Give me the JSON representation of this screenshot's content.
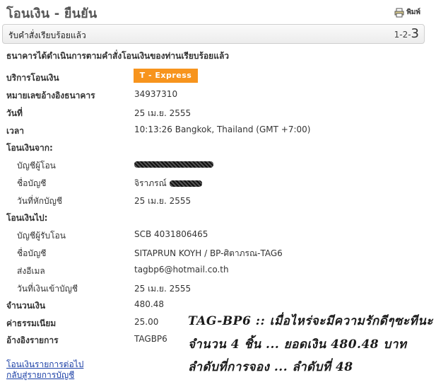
{
  "header": {
    "title": "โอนเงิน - ยืนยัน",
    "print_label": "พิมพ์"
  },
  "status": {
    "message": "รับคำสั่งเรียบร้อยแล้ว",
    "steps_prefix": "1-2-",
    "steps_current": "3"
  },
  "notice": "ธนาคารได้ดำเนินการตามคำสั่งโอนเงินของท่านเรียบร้อยแล้ว",
  "details": {
    "service_label": "บริการโอนเงิน",
    "service_value": "T - Express",
    "reference_label": "หมายเลขอ้างอิงธนาคาร",
    "reference_value": "34937310",
    "date_label": "วันที่",
    "date_value": "25 เม.ย. 2555",
    "time_label": "เวลา",
    "time_value": "10:13:26 Bangkok, Thailand (GMT +7:00)"
  },
  "from": {
    "heading": "โอนเงินจาก:",
    "account_label": "บัญชีผู้โอน",
    "name_label": "ชื่อบัญชี",
    "name_value_visible": "จิราภรณ์",
    "debit_date_label": "วันที่หักบัญชี",
    "debit_date_value": "25 เม.ย. 2555"
  },
  "to": {
    "heading": "โอนเงินไป:",
    "account_label": "บัญชีผู้รับโอน",
    "account_value": "SCB 4031806465",
    "name_label": "ชื่อบัญชี",
    "name_value": "SITAPRUN KOYH / BP-ศิตาภรณ-TAG6",
    "email_label": "ส่งอีเมล",
    "email_value": "tagbp6@hotmail.co.th",
    "credit_date_label": "วันที่เงินเข้าบัญชี",
    "credit_date_value": "25 เม.ย. 2555"
  },
  "amount": {
    "label": "จำนวนเงิน",
    "value": "480.48"
  },
  "fee": {
    "label": "ค่าธรรมเนียม",
    "value": "25.00"
  },
  "note_ref": {
    "label": "อ้างอิงรายการ",
    "value": "TAGBP6"
  },
  "links": {
    "next_transfer": "โอนเงินรายการต่อไป",
    "back_to_accounts": "กลับสู่รายการบัญชี"
  },
  "handwriting": {
    "line1": "TAG-BP6 :: เมื่อไหร่จะมีความรักดีๆซะทีนะ",
    "line2": "จำนวน 4 ชิ้น ... ยอดเงิน 480.48 บาท",
    "line3": "ลำดับที่การจอง ... ลำดับที่ 48"
  },
  "colors": {
    "badge": "#f7941d",
    "link": "#1a3fa6"
  }
}
